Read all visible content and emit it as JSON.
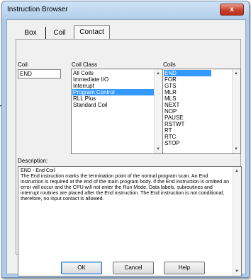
{
  "window": {
    "title": "Instruction Browser",
    "close_glyph": "x"
  },
  "tabs": [
    {
      "label": "Box",
      "active": false
    },
    {
      "label": "Coil",
      "active": false
    },
    {
      "label": "Contact",
      "active": true
    }
  ],
  "coil": {
    "label": "Coil",
    "value": "END"
  },
  "coil_class": {
    "label": "Coil Class",
    "items": [
      "All Coils",
      "Immediate I/O",
      "Interrupt",
      "Program Control",
      "RLL Plus",
      "Standard Coil"
    ],
    "selected": "Program Control"
  },
  "coils": {
    "label": "Coils",
    "items": [
      "END",
      "FOR",
      "GTS",
      "MLR",
      "MLS",
      "NEXT",
      "NOP",
      "PAUSE",
      "RSTWT",
      "RT",
      "RTC",
      "STOP"
    ],
    "selected": "END"
  },
  "description": {
    "label": "Description:",
    "heading": "END - End Coil",
    "body": "The End instruction marks the termination point of the normal program scan. An End instruction is required at the end of the main program body. If the End instruction is omitted an error will occur and the CPU will not enter the Run Mode. Data labels, subroutines and interrupt routines are placed after the End instruction. The End instruction is not conditional; therefore, no input contact is allowed."
  },
  "buttons": {
    "ok": "OK",
    "cancel": "Cancel",
    "help": "Help"
  },
  "colors": {
    "selection": "#3399ff",
    "window_frame": "#aecbe9",
    "close": "#c8432c"
  }
}
